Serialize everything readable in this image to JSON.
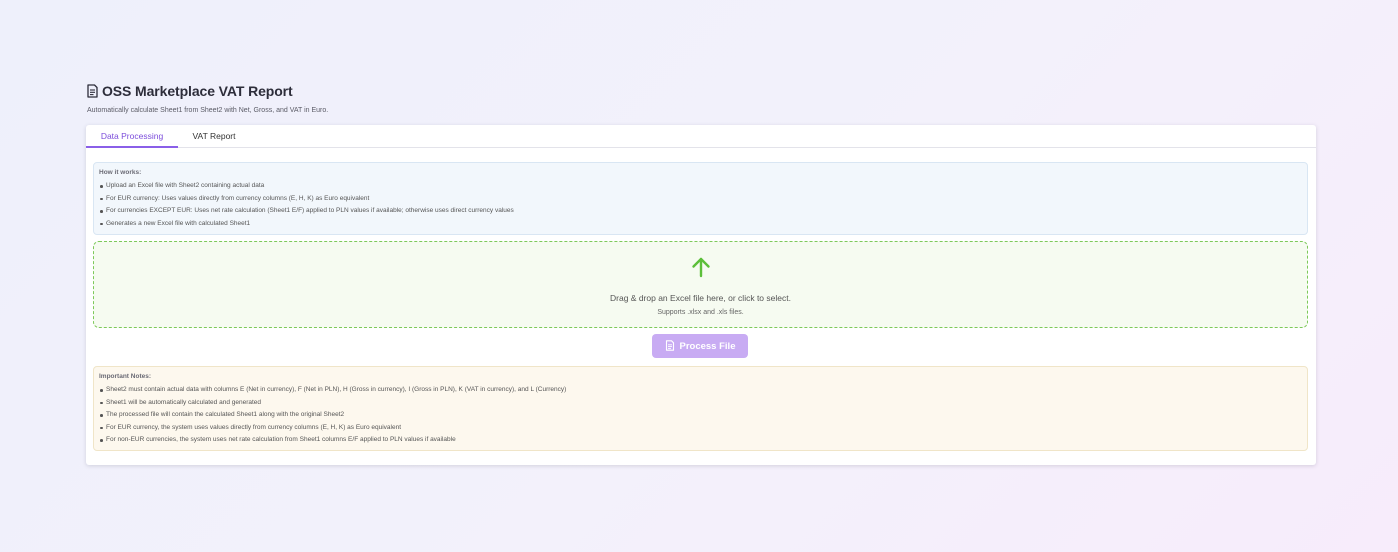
{
  "header": {
    "title": "OSS Marketplace VAT Report",
    "subtitle": "Automatically calculate Sheet1 from Sheet2 with Net, Gross, and VAT in Euro.",
    "icon": "document-icon"
  },
  "tabs": [
    {
      "label": "Data Processing",
      "active": true
    },
    {
      "label": "VAT Report",
      "active": false
    }
  ],
  "how_it_works": {
    "heading": "How it works:",
    "items": [
      "Upload an Excel file with Sheet2 containing actual data",
      "For EUR currency: Uses values directly from currency columns (E, H, K) as Euro equivalent",
      "For currencies EXCEPT EUR: Uses net rate calculation (Sheet1 E/F) applied to PLN values if available; otherwise uses direct currency values",
      "Generates a new Excel file with calculated Sheet1"
    ]
  },
  "dropzone": {
    "icon": "arrow-up-icon",
    "text": "Drag & drop an Excel file here, or click to select.",
    "subtext": "Supports .xlsx and .xls files."
  },
  "process_button": {
    "label": "Process File",
    "icon": "document-icon"
  },
  "notes": {
    "heading": "Important Notes:",
    "items": [
      "Sheet2 must contain actual data with columns E (Net in currency), F (Net in PLN), H (Gross in currency), I (Gross in PLN), K (VAT in currency), and L (Currency)",
      "Sheet1 will be automatically calculated and generated",
      "The processed file will contain the calculated Sheet1 along with the original Sheet2",
      "For EUR currency, the system uses values directly from currency columns (E, H, K) as Euro equivalent",
      "For non-EUR currencies, the system uses net rate calculation from Sheet1 columns E/F applied to PLN values if available"
    ]
  },
  "colors": {
    "accent": "#8a5fe8",
    "dropzone_border": "#7dc95a",
    "button_disabled": "#c8abf3"
  }
}
